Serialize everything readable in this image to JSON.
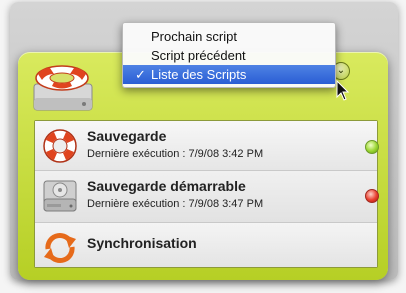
{
  "menu": {
    "items": [
      {
        "label": "Prochain script",
        "checked": false
      },
      {
        "label": "Script précédent",
        "checked": false
      },
      {
        "label": "Liste des Scripts",
        "checked": true,
        "check_mark": "✓"
      }
    ]
  },
  "scripts": [
    {
      "title": "Sauvegarde",
      "subtitle": "Dernière exécution : 7/9/08 3:42 PM",
      "status": "success",
      "icon": "life-ring-icon"
    },
    {
      "title": "Sauvegarde démarrable",
      "subtitle": "Dernière exécution : 7/9/08 3:47 PM",
      "status": "error",
      "icon": "hard-drive-icon"
    },
    {
      "title": "Synchronisation",
      "subtitle": "",
      "status": "",
      "icon": "sync-arrows-icon"
    }
  ],
  "colors": {
    "widget_green": "#c6dc3c",
    "menu_highlight": "#3a6bdc",
    "status_green": "#8fd02a",
    "status_red": "#e33a2a",
    "life_ring_red": "#e0441f",
    "sync_orange": "#e66a1a"
  },
  "header": {
    "icon": "drive-with-life-ring-icon",
    "expand_glyph": "⌄"
  }
}
